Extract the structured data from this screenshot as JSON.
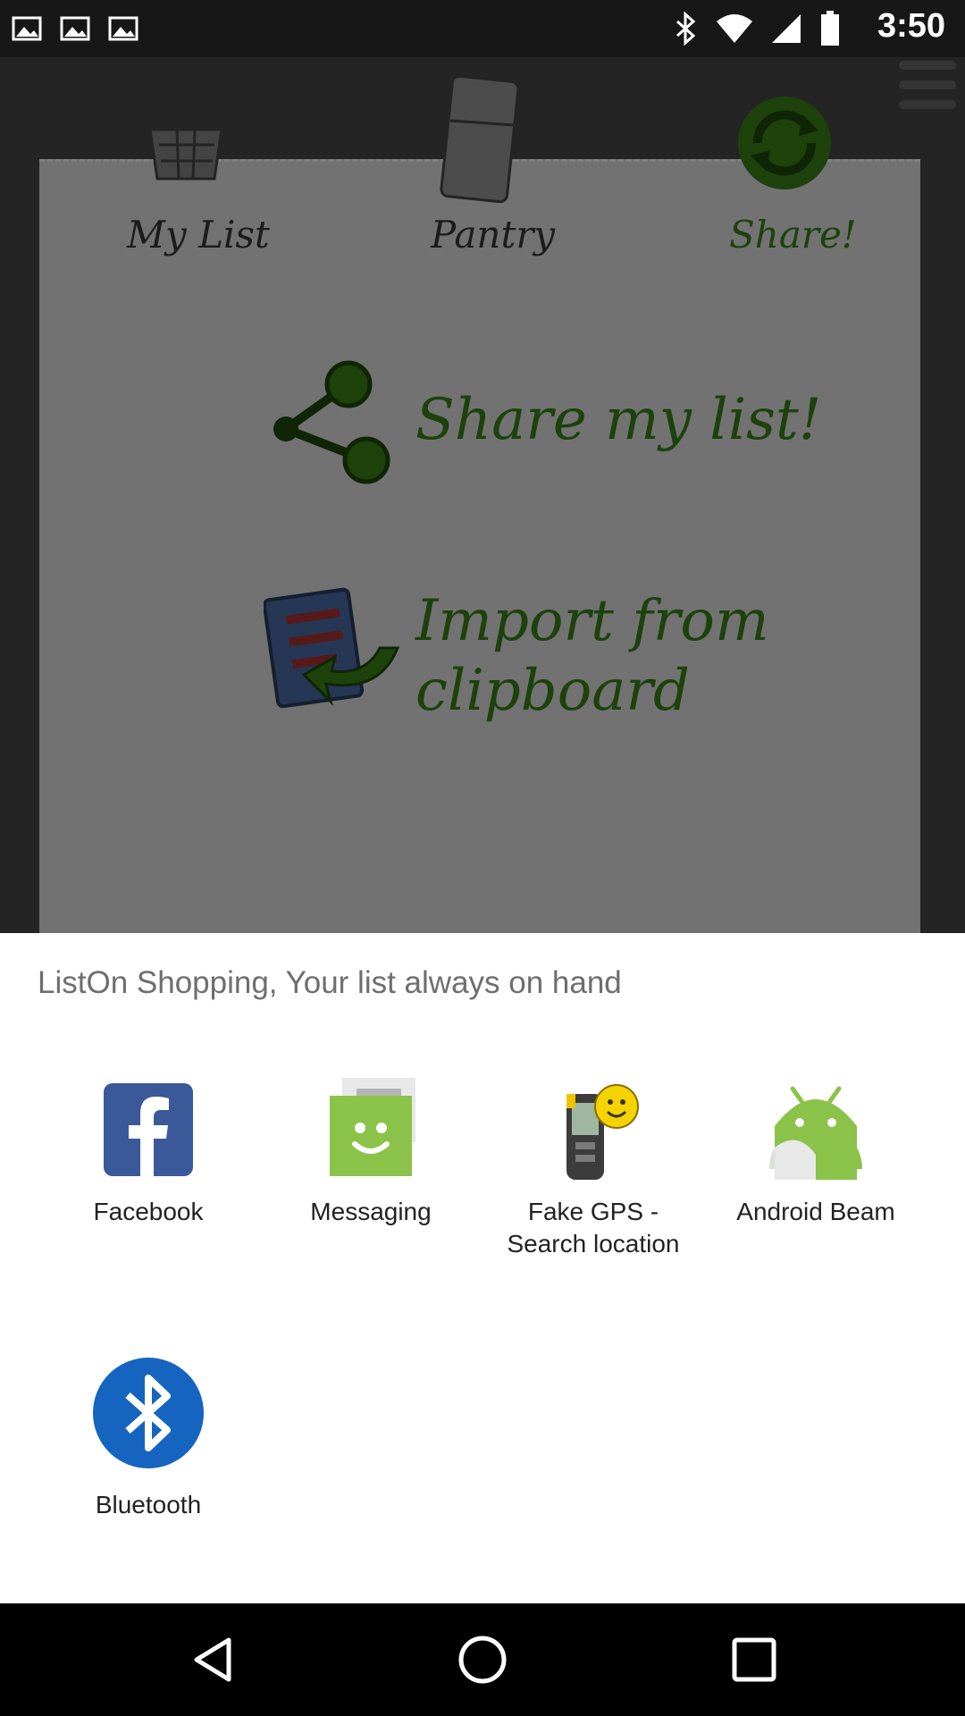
{
  "status_bar": {
    "time": "3:50"
  },
  "background_app": {
    "tabs": [
      {
        "label": "My List"
      },
      {
        "label": "Pantry"
      },
      {
        "label": "Share!"
      }
    ],
    "actions": {
      "share": "Share my list!",
      "import_line1": "Import from",
      "import_line2": "clipboard"
    }
  },
  "share_sheet": {
    "title": "ListOn Shopping, Your list always on hand",
    "apps": [
      {
        "label": "Facebook",
        "icon": "facebook-icon"
      },
      {
        "label": "Messaging",
        "icon": "messaging-icon"
      },
      {
        "label": "Fake GPS - Search location",
        "icon": "gps-device-icon"
      },
      {
        "label": "Android Beam",
        "icon": "android-icon"
      },
      {
        "label": "Bluetooth",
        "icon": "bluetooth-icon"
      }
    ]
  },
  "nav_bar": {
    "buttons": [
      "back-icon",
      "home-icon",
      "recents-icon"
    ]
  },
  "colors": {
    "facebook": "#3b5998",
    "messaging": "#8bc34a",
    "android": "#8bc34a",
    "bluetooth": "#1565c0",
    "app_green": "#2f6b14"
  }
}
